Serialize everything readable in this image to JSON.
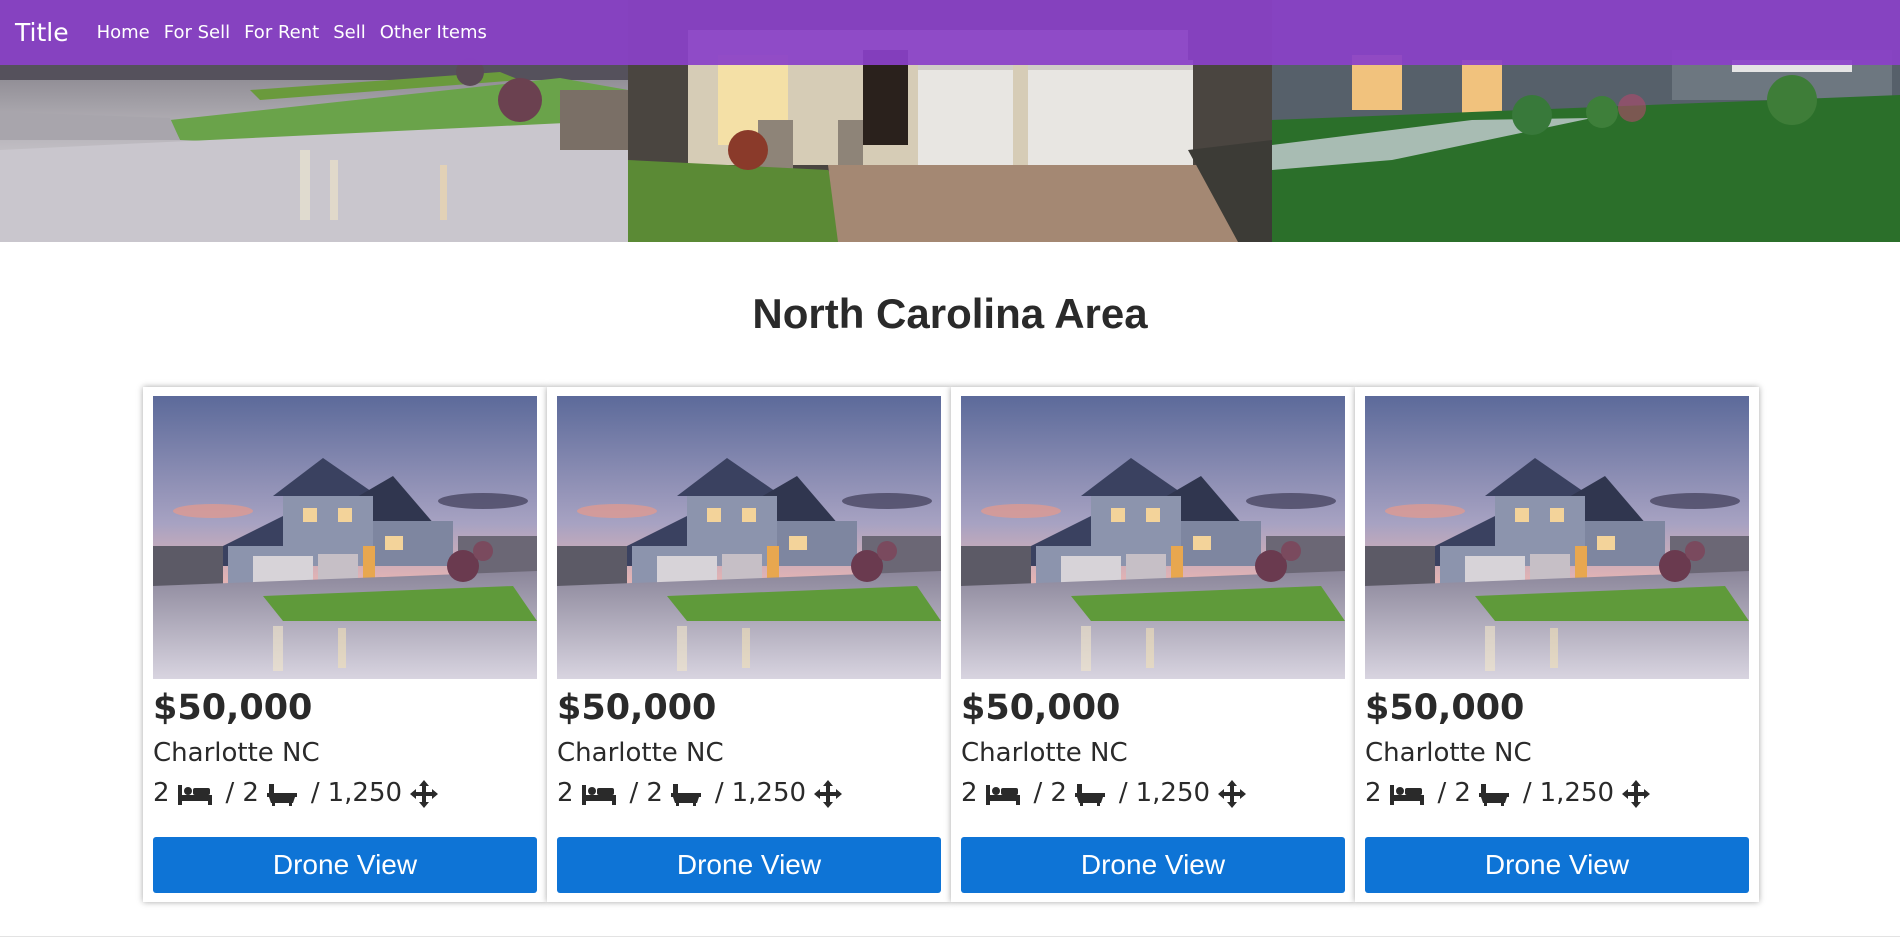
{
  "navbar": {
    "brand": "Title",
    "links": [
      "Home",
      "For Sell",
      "For Rent",
      "Sell",
      "Other Items"
    ]
  },
  "heading": "North Carolina Area",
  "listings": [
    {
      "price": "$50,000",
      "location": "Charlotte NC",
      "beds": "2",
      "baths": "2",
      "sqft": "1,250",
      "button": "Drone View"
    },
    {
      "price": "$50,000",
      "location": "Charlotte NC",
      "beds": "2",
      "baths": "2",
      "sqft": "1,250",
      "button": "Drone View"
    },
    {
      "price": "$50,000",
      "location": "Charlotte NC",
      "beds": "2",
      "baths": "2",
      "sqft": "1,250",
      "button": "Drone View"
    },
    {
      "price": "$50,000",
      "location": "Charlotte NC",
      "beds": "2",
      "baths": "2",
      "sqft": "1,250",
      "button": "Drone View"
    }
  ],
  "icons": {
    "beds": "bed-icon",
    "baths": "bath-icon",
    "area": "arrows-move-icon"
  },
  "colors": {
    "navbar": "#8a41c8",
    "button": "#0e74d6",
    "text": "#2a2a2a"
  }
}
